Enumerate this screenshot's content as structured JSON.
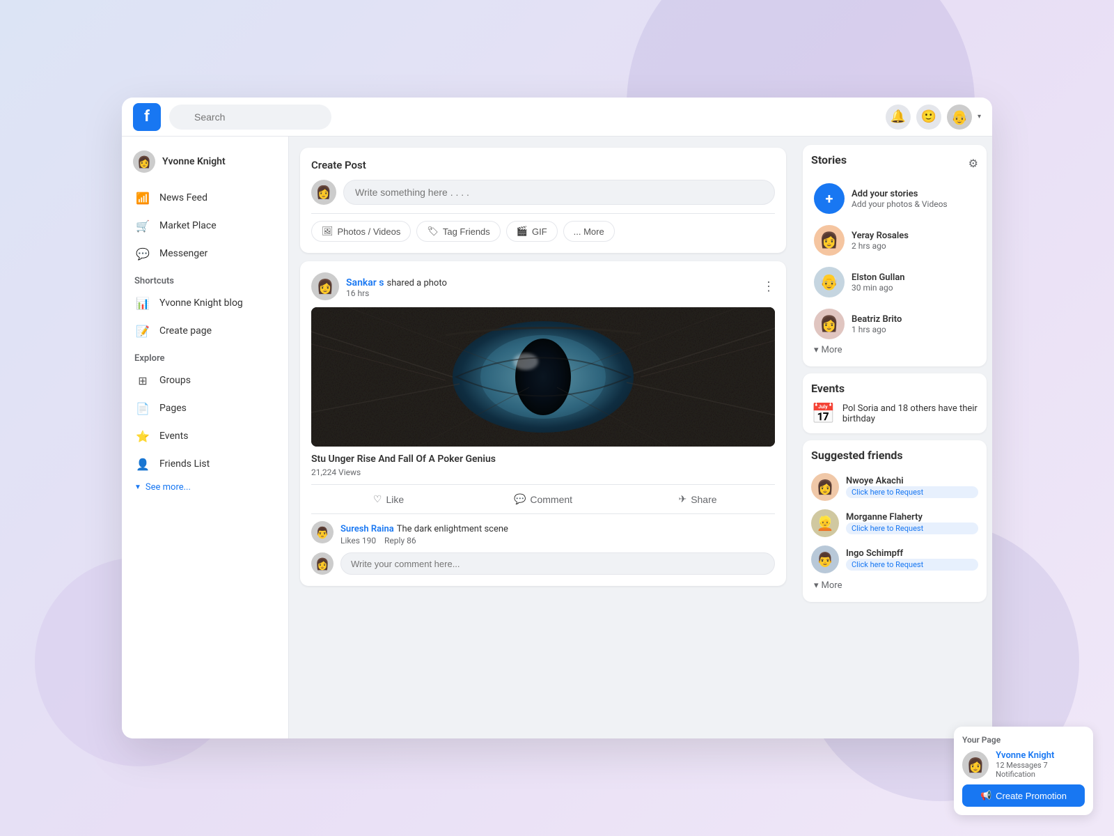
{
  "app": {
    "title": "Facebook",
    "logo_letter": "f"
  },
  "navbar": {
    "search_placeholder": "Search",
    "user_avatar": "👴",
    "dropdown_arrow": "▾"
  },
  "sidebar": {
    "profile_name": "Yvonne Knight",
    "profile_avatar": "👩",
    "nav_items": [
      {
        "id": "news-feed",
        "label": "News Feed",
        "icon": "📶"
      },
      {
        "id": "marketplace",
        "label": "Market Place",
        "icon": "🛒"
      },
      {
        "id": "messenger",
        "label": "Messenger",
        "icon": "💬"
      }
    ],
    "shortcuts_title": "Shortcuts",
    "shortcuts": [
      {
        "id": "blog",
        "label": "Yvonne Knight blog",
        "icon": "📊"
      },
      {
        "id": "create-page",
        "label": "Create page",
        "icon": "📝"
      }
    ],
    "explore_title": "Explore",
    "explore_items": [
      {
        "id": "groups",
        "label": "Groups",
        "icon": "⊞"
      },
      {
        "id": "pages",
        "label": "Pages",
        "icon": "📄"
      },
      {
        "id": "events",
        "label": "Events",
        "icon": "⭐"
      },
      {
        "id": "friends-list",
        "label": "Friends List",
        "icon": "👤"
      }
    ],
    "see_more": "See more..."
  },
  "create_post": {
    "title": "Create Post",
    "placeholder": "Write something here . . . .",
    "user_avatar": "👩",
    "actions": [
      {
        "id": "photos-videos",
        "label": "Photos / Videos",
        "icon": "🖼"
      },
      {
        "id": "tag-friends",
        "label": "Tag Friends",
        "icon": "🏷"
      },
      {
        "id": "gif",
        "label": "GIF",
        "icon": "🎬"
      },
      {
        "id": "more",
        "label": "... More",
        "icon": ""
      }
    ]
  },
  "post": {
    "author": "Sankar s",
    "shared_text": "shared a photo",
    "time": "16 hrs",
    "avatar": "👩",
    "title": "Stu Unger Rise And Fall Of A Poker Genius",
    "views": "21,224 Views",
    "reactions": [
      {
        "id": "like",
        "label": "Like",
        "icon": "♡"
      },
      {
        "id": "comment",
        "label": "Comment",
        "icon": "💬"
      },
      {
        "id": "share",
        "label": "Share",
        "icon": "✈"
      }
    ],
    "comment": {
      "author": "Suresh Raina",
      "text": "The dark enlightment scene",
      "likes": "Likes  190",
      "replies": "Reply  86",
      "avatar": "👨"
    },
    "comment_input_placeholder": "Write your comment here...",
    "commenter_avatar": "👩"
  },
  "stories": {
    "title": "Stories",
    "add_story": {
      "name": "Add your stories",
      "sub": "Add your photos & Videos"
    },
    "items": [
      {
        "name": "Yeray Rosales",
        "time": "2 hrs ago",
        "avatar": "👩"
      },
      {
        "name": "Elston Gullan",
        "time": "30 min ago",
        "avatar": "👴"
      },
      {
        "name": "Beatriz Brito",
        "time": "1 hrs ago",
        "avatar": "👩"
      }
    ],
    "more_label": "More"
  },
  "events": {
    "title": "Events",
    "text": "Pol Soria and 18 others have their birthday",
    "icon": "📅"
  },
  "suggested_friends": {
    "title": "Suggested friends",
    "items": [
      {
        "name": "Nwoye Akachi",
        "action": "Click here to Request",
        "avatar": "👩"
      },
      {
        "name": "Morganne Flaherty",
        "action": "Click here to Request",
        "avatar": "👱"
      },
      {
        "name": "Ingo Schimpff",
        "action": "Click here to Request",
        "avatar": "👨"
      }
    ],
    "more_label": "More"
  },
  "your_page": {
    "title": "Your Page",
    "name": "Yvonne Knight",
    "meta": "12 Messages  7 Notification",
    "avatar": "👩",
    "cta": "Create Promotion"
  }
}
